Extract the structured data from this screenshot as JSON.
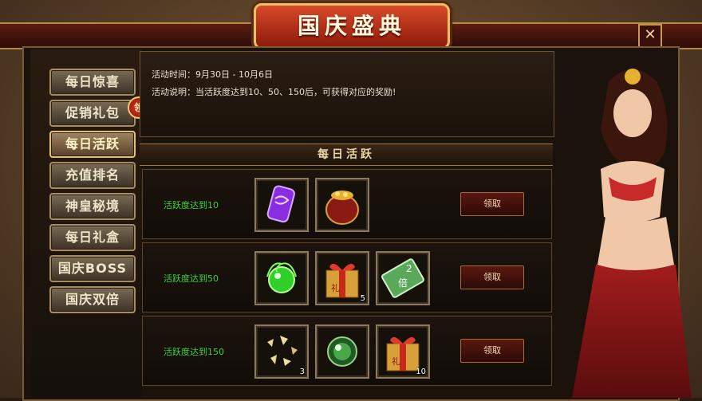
{
  "window": {
    "title": "国庆盛典",
    "close_label": "✕"
  },
  "sidebar": {
    "items": [
      {
        "label": "每日惊喜",
        "active": false
      },
      {
        "label": "促销礼包",
        "active": false
      },
      {
        "label": "每日活跃",
        "active": true
      },
      {
        "label": "充值排名",
        "active": false
      },
      {
        "label": "神皇秘境",
        "active": false
      },
      {
        "label": "每日礼盒",
        "active": false
      },
      {
        "label": "国庆BOSS",
        "active": false
      },
      {
        "label": "国庆双倍",
        "active": false
      }
    ],
    "badge": "领"
  },
  "info": {
    "time": "活动时间：9月30日 - 10月6日",
    "desc": "活动说明：当活跃度达到10、50、150后，可获得对应的奖励!"
  },
  "section": {
    "title": "每日活跃"
  },
  "rewards": [
    {
      "label": "活跃度达到10",
      "button": "领取",
      "items": [
        {
          "icon": "purple-scroll-icon",
          "count": ""
        },
        {
          "icon": "gold-pot-icon",
          "count": ""
        }
      ]
    },
    {
      "label": "活跃度达到50",
      "button": "领取",
      "items": [
        {
          "icon": "green-orb-icon",
          "count": ""
        },
        {
          "icon": "gift-box-icon",
          "count": "5"
        },
        {
          "icon": "double-card-icon",
          "count": ""
        }
      ]
    },
    {
      "label": "活跃度达到150",
      "button": "领取",
      "items": [
        {
          "icon": "gold-shards-icon",
          "count": "3"
        },
        {
          "icon": "green-pearl-icon",
          "count": ""
        },
        {
          "icon": "gift-box-icon",
          "count": "10"
        }
      ]
    }
  ],
  "icon_texts": {
    "gift": "礼",
    "double_top": "2",
    "double_bottom": "倍"
  },
  "colors": {
    "green_text": "#3cd23c",
    "accent_red": "#8e1a0c",
    "gold": "#e7c06a"
  }
}
